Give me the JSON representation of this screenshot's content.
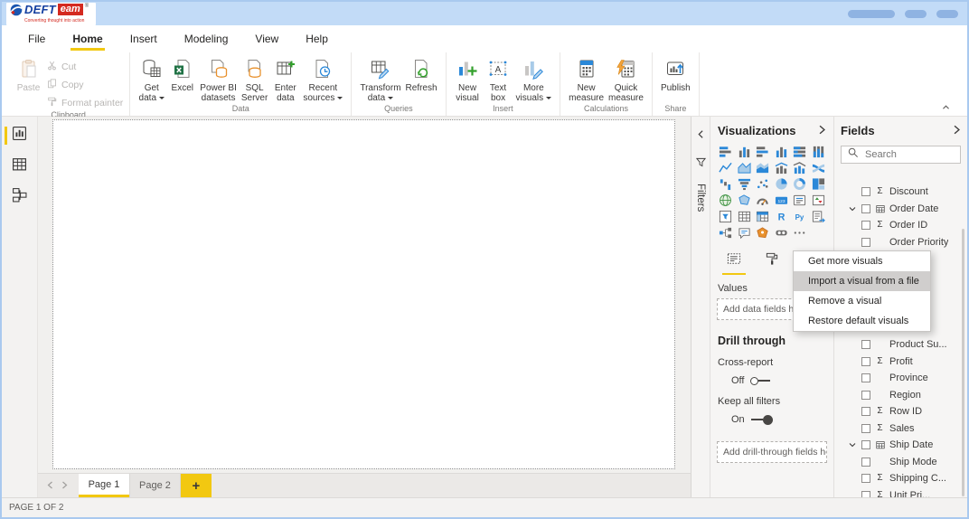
{
  "logo": {
    "text_primary": "DEFT",
    "text_secondary": "eam",
    "registered": "®",
    "tagline": "Converting thought into action"
  },
  "menubar": {
    "items": [
      "File",
      "Home",
      "Insert",
      "Modeling",
      "View",
      "Help"
    ],
    "active": "Home"
  },
  "ribbon": {
    "groups": [
      {
        "label": "Clipboard",
        "items": [
          {
            "name": "paste",
            "label": "Paste",
            "icon": "paste",
            "disabled": true
          },
          {
            "name": "cut",
            "label": "Cut",
            "icon": "cut",
            "disabled": true,
            "small": true
          },
          {
            "name": "copy",
            "label": "Copy",
            "icon": "copy",
            "disabled": true,
            "small": true
          },
          {
            "name": "format-painter",
            "label": "Format painter",
            "icon": "format-painter",
            "disabled": true,
            "small": true
          }
        ]
      },
      {
        "label": "Data",
        "items": [
          {
            "name": "get-data",
            "label": "Get\ndata",
            "icon": "get-data",
            "dropdown": true
          },
          {
            "name": "excel",
            "label": "Excel",
            "icon": "excel"
          },
          {
            "name": "power-bi-datasets",
            "label": "Power BI\ndatasets",
            "icon": "pbi-datasets"
          },
          {
            "name": "sql-server",
            "label": "SQL\nServer",
            "icon": "sql-server"
          },
          {
            "name": "enter-data",
            "label": "Enter\ndata",
            "icon": "enter-data"
          },
          {
            "name": "recent-sources",
            "label": "Recent\nsources",
            "icon": "recent-sources",
            "dropdown": true
          }
        ]
      },
      {
        "label": "Queries",
        "items": [
          {
            "name": "transform-data",
            "label": "Transform\ndata",
            "icon": "transform-data",
            "dropdown": true
          },
          {
            "name": "refresh",
            "label": "Refresh",
            "icon": "refresh"
          }
        ]
      },
      {
        "label": "Insert",
        "items": [
          {
            "name": "new-visual",
            "label": "New\nvisual",
            "icon": "new-visual"
          },
          {
            "name": "text-box",
            "label": "Text\nbox",
            "icon": "text-box"
          },
          {
            "name": "more-visuals",
            "label": "More\nvisuals",
            "icon": "more-visuals",
            "dropdown": true
          }
        ]
      },
      {
        "label": "Calculations",
        "items": [
          {
            "name": "new-measure",
            "label": "New\nmeasure",
            "icon": "new-measure"
          },
          {
            "name": "quick-measure",
            "label": "Quick\nmeasure",
            "icon": "quick-measure"
          }
        ]
      },
      {
        "label": "Share",
        "items": [
          {
            "name": "publish",
            "label": "Publish",
            "icon": "publish"
          }
        ]
      }
    ]
  },
  "sidebar": {
    "items": [
      {
        "name": "report-view",
        "active": true
      },
      {
        "name": "data-view",
        "active": false
      },
      {
        "name": "model-view",
        "active": false
      }
    ]
  },
  "filters": {
    "label": "Filters"
  },
  "visualizations": {
    "title": "Visualizations",
    "icons": [
      "stacked-bar-chart",
      "stacked-column-chart",
      "clustered-bar-chart",
      "clustered-column-chart",
      "hundred-stacked-bar-chart",
      "hundred-stacked-column-chart",
      "line-chart",
      "area-chart",
      "stacked-area-chart",
      "line-and-stacked-column-chart",
      "line-and-clustered-column-chart",
      "ribbon-chart",
      "waterfall-chart",
      "funnel-chart",
      "scatter-chart",
      "pie-chart",
      "donut-chart",
      "treemap",
      "map",
      "filled-map",
      "gauge",
      "card",
      "multi-row-card",
      "kpi",
      "slicer",
      "table",
      "matrix",
      "r-script-visual",
      "python-visual",
      "paginated-report",
      "key-influencers",
      "qa-visual",
      "arcgis-map",
      "metrics-visual",
      "more-options-ellipsis"
    ],
    "values_label": "Values",
    "add_data_placeholder": "Add data fields here",
    "drill_through": {
      "title": "Drill through",
      "cross_report_label": "Cross-report",
      "cross_report_state": "Off",
      "keep_filters_label": "Keep all filters",
      "keep_filters_state": "On",
      "add_placeholder": "Add drill-through fields here"
    }
  },
  "fields": {
    "title": "Fields",
    "search_placeholder": "Search",
    "items_above_menu": [
      {
        "label": "Discount",
        "sigma": true
      },
      {
        "label": "Order Date",
        "date": true,
        "expandable": true
      },
      {
        "label": "Order ID",
        "sigma": true
      },
      {
        "label": "Order Priority"
      }
    ],
    "items_below_menu": [
      {
        "label": "Product Su..."
      },
      {
        "label": "Profit",
        "sigma": true
      },
      {
        "label": "Province"
      },
      {
        "label": "Region"
      },
      {
        "label": "Row ID",
        "sigma": true
      },
      {
        "label": "Sales",
        "sigma": true
      },
      {
        "label": "Ship Date",
        "date": true,
        "expandable": true
      },
      {
        "label": "Ship Mode"
      },
      {
        "label": "Shipping C...",
        "sigma": true
      },
      {
        "label": "Unit Pri...",
        "sigma": true
      }
    ]
  },
  "context_menu": {
    "items": [
      {
        "label": "Get more visuals"
      },
      {
        "label": "Import a visual from a file",
        "highlighted": true
      },
      {
        "label": "Remove a visual"
      },
      {
        "label": "Restore default visuals"
      }
    ]
  },
  "pages": {
    "tabs": [
      {
        "label": "Page 1",
        "active": true
      },
      {
        "label": "Page 2",
        "active": false
      }
    ],
    "add_label": "+"
  },
  "statusbar": {
    "text": "PAGE 1 OF 2"
  },
  "colors": {
    "accent_yellow": "#f2c811",
    "titlebar_blue": "#c2dbf7",
    "menu_highlight_gray": "#d0cecd",
    "logo_red": "#d42a20",
    "logo_blue": "#1540a0"
  }
}
